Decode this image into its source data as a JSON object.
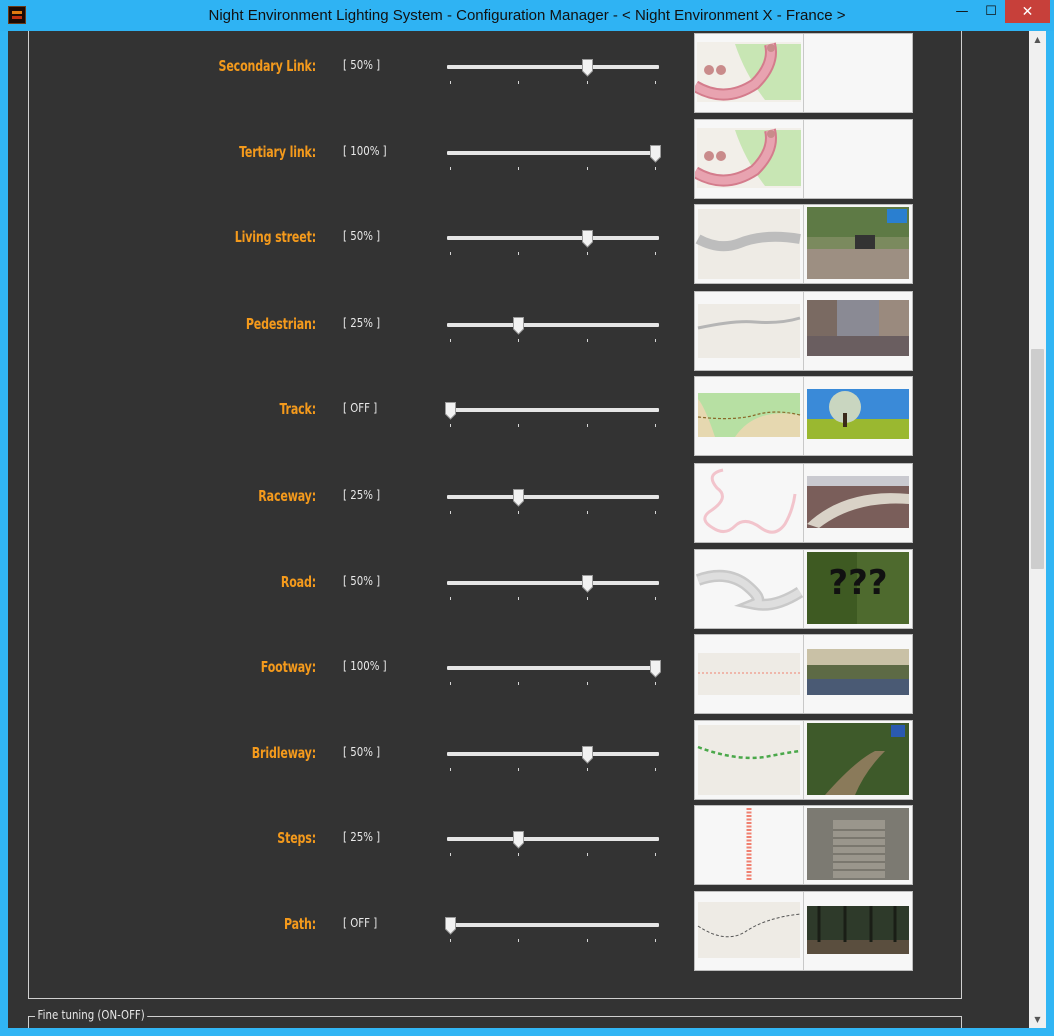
{
  "window": {
    "title": "Night Environment Lighting System - Configuration Manager - < Night Environment X - France >",
    "minimize_glyph": "—",
    "maximize_glyph": "☐",
    "close_glyph": "✕"
  },
  "rows": [
    {
      "label": "Secondary Link:",
      "value": "[ 50% ]",
      "level": 0.5,
      "map": "link-map",
      "photo": "none"
    },
    {
      "label": "Tertiary link:",
      "value": "[ 100% ]",
      "level": 1.0,
      "map": "link-map",
      "photo": "none"
    },
    {
      "label": "Living street:",
      "value": "[ 50% ]",
      "level": 0.5,
      "map": "grey-road",
      "photo": "street-photo"
    },
    {
      "label": "Pedestrian:",
      "value": "[ 25% ]",
      "level": 0.25,
      "map": "thin-road",
      "photo": "pedestrian-photo"
    },
    {
      "label": "Track:",
      "value": "[ OFF ]",
      "level": 0.0,
      "map": "track-map",
      "photo": "tree-photo"
    },
    {
      "label": "Raceway:",
      "value": "[ 25% ]",
      "level": 0.25,
      "map": "raceway-map",
      "photo": "stadium-photo"
    },
    {
      "label": "Road:",
      "value": "[ 50% ]",
      "level": 0.5,
      "map": "curvy-road",
      "photo": "question-photo"
    },
    {
      "label": "Footway:",
      "value": "[ 100% ]",
      "level": 1.0,
      "map": "footway-map",
      "photo": "footway-photo"
    },
    {
      "label": "Bridleway:",
      "value": "[ 50% ]",
      "level": 0.5,
      "map": "bridleway-map",
      "photo": "forest-path-photo"
    },
    {
      "label": "Steps:",
      "value": "[ 25% ]",
      "level": 0.25,
      "map": "steps-map",
      "photo": "steps-photo"
    },
    {
      "label": "Path:",
      "value": "[ OFF ]",
      "level": 0.0,
      "map": "path-map",
      "photo": "dark-forest-photo"
    }
  ],
  "fine_tuning": {
    "legend": "Fine tuning (ON-OFF)"
  },
  "colors": {
    "label": "#f49a1c",
    "background": "#333333",
    "titlebar": "#2fb3f3",
    "close": "#c7403a"
  }
}
